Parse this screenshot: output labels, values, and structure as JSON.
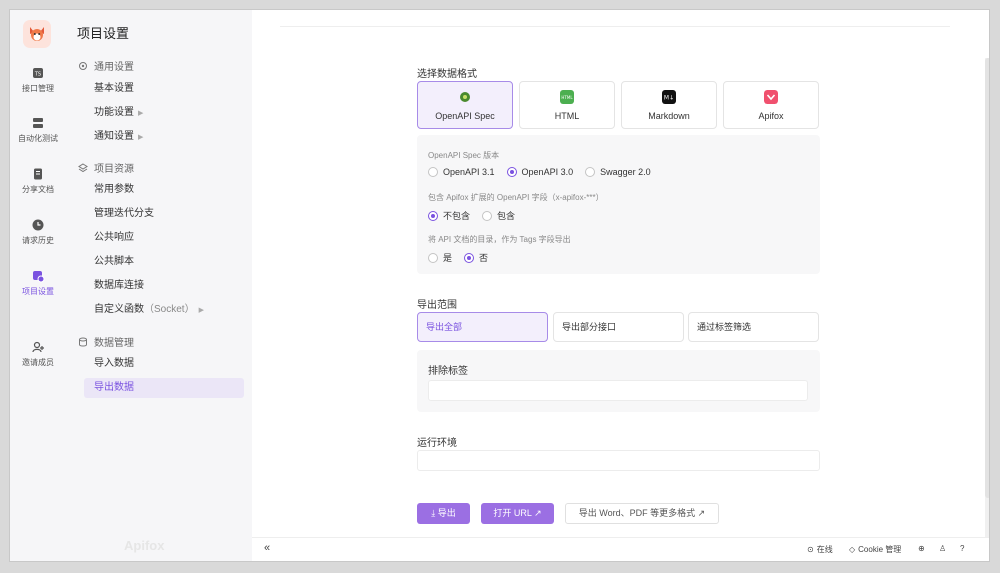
{
  "rail": {
    "items": [
      {
        "label": "接口管理",
        "icon": "api-icon"
      },
      {
        "label": "自动化测试",
        "icon": "test-icon"
      },
      {
        "label": "分享文档",
        "icon": "doc-icon"
      },
      {
        "label": "请求历史",
        "icon": "history-icon"
      },
      {
        "label": "项目设置",
        "icon": "settings-icon"
      },
      {
        "label": "邀请成员",
        "icon": "invite-icon"
      }
    ]
  },
  "sidebar": {
    "title": "项目设置",
    "groups": {
      "general": "通用设置",
      "resources": "项目资源",
      "data": "数据管理"
    },
    "items": {
      "basic": "基本设置",
      "features": "功能设置",
      "notify": "通知设置",
      "params": "常用参数",
      "branches": "管理迭代分支",
      "responses": "公共响应",
      "scripts": "公共脚本",
      "db": "数据库连接",
      "custom_fn": "自定义函数",
      "custom_fn_sub": "（Socket）",
      "import": "导入数据",
      "export": "导出数据"
    },
    "watermark": "Apifox"
  },
  "main": {
    "format_label": "选择数据格式",
    "formats": [
      {
        "label": "OpenAPI Spec",
        "color": "#4a8a2e"
      },
      {
        "label": "HTML",
        "color": "#4caf50"
      },
      {
        "label": "Markdown",
        "color": "#111111"
      },
      {
        "label": "Apifox",
        "color": "#f0506e"
      }
    ],
    "version_label": "OpenAPI Spec 版本",
    "versions": [
      "OpenAPI 3.1",
      "OpenAPI 3.0",
      "Swagger 2.0"
    ],
    "ext_label": "包含 Apifox 扩展的 OpenAPI 字段（x-apifox-***）",
    "ext_options": [
      "不包含",
      "包含"
    ],
    "tags_label": "将 API 文档的目录，作为 Tags 字段导出",
    "tags_options": [
      "是",
      "否"
    ],
    "scope_label": "导出范围",
    "scopes": [
      "导出全部",
      "导出部分接口",
      "通过标签筛选"
    ],
    "exclude_label": "排除标签",
    "env_label": "运行环境",
    "btn_export": "导出",
    "btn_open_url": "打开 URL",
    "btn_more": "导出 Word、PDF 等更多格式"
  },
  "bottombar": {
    "online": "在线",
    "cookie": "Cookie 管理"
  },
  "accent": "#7a52e0"
}
